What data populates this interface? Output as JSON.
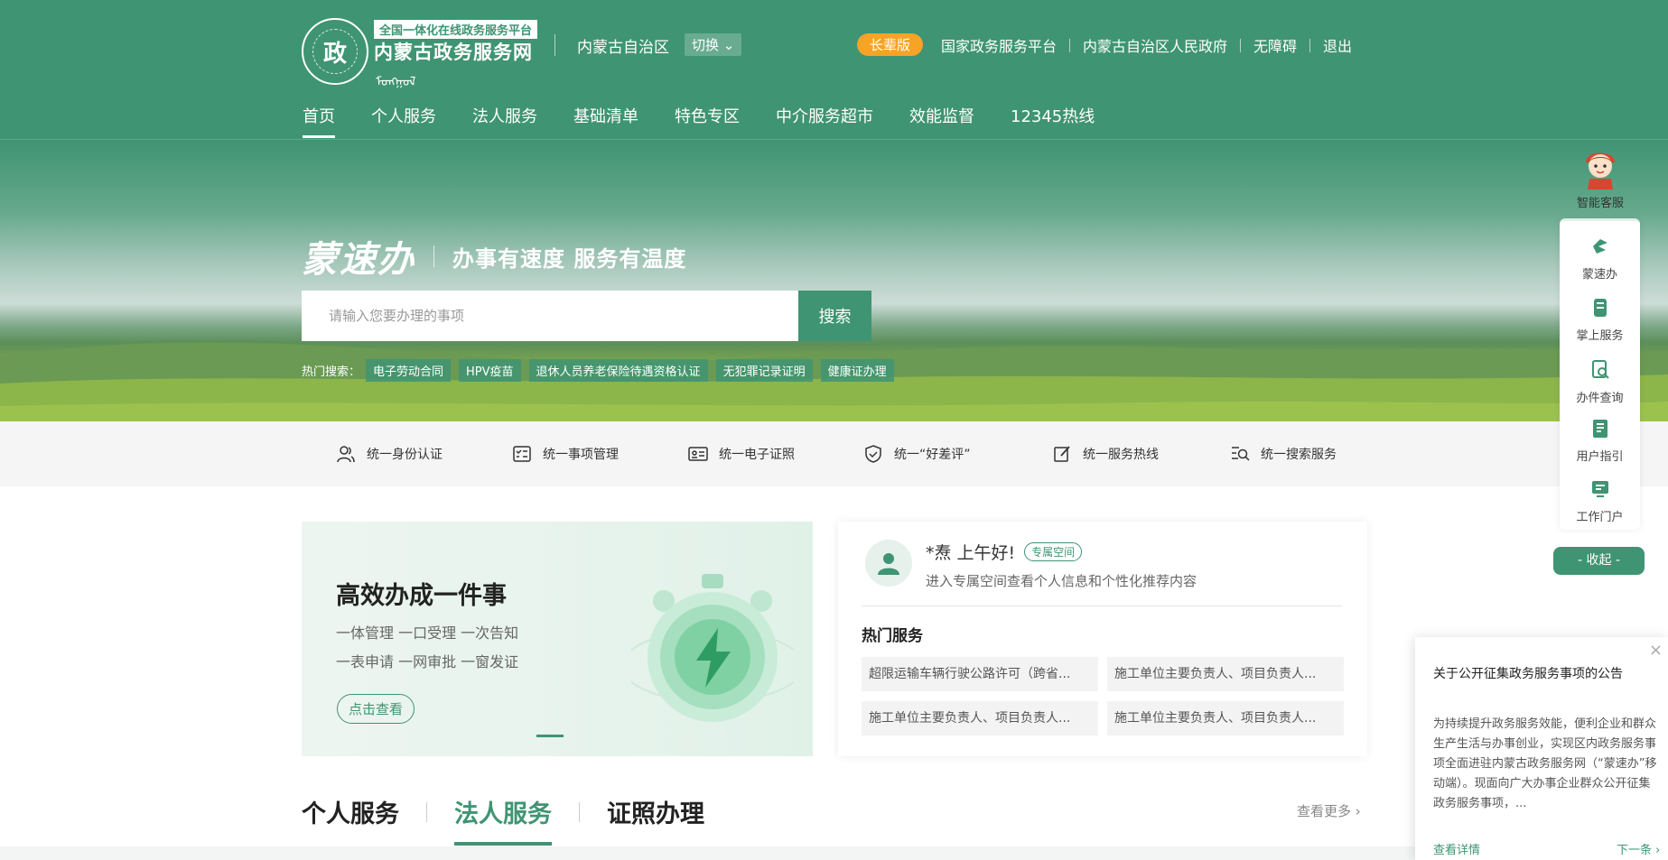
{
  "header": {
    "logo_tag": "全国一体化在线政务服务平台",
    "logo_name": "内蒙古政务服务网",
    "logo_emblem_text": "政",
    "region": "内蒙古自治区",
    "switch_label": "切换",
    "elder_label": "长辈版",
    "links": [
      "国家政务服务平台",
      "内蒙古自治区人民政府",
      "无障碍",
      "退出"
    ]
  },
  "nav": [
    "首页",
    "个人服务",
    "法人服务",
    "基础清单",
    "特色专区",
    "中介服务超市",
    "效能监督",
    "12345热线"
  ],
  "banner": {
    "calligraphy": "蒙速办",
    "slogan": "办事有速度  服务有温度",
    "search_placeholder": "请输入您要办理的事项",
    "search_button": "搜索",
    "hot_label": "热门搜索：",
    "hot_items": [
      "电子劳动合同",
      "HPV疫苗",
      "退休人员养老保险待遇资格认证",
      "无犯罪记录证明",
      "健康证办理"
    ]
  },
  "unified": [
    "统一身份认证",
    "统一事项管理",
    "统一电子证照",
    "统一“好差评”",
    "统一服务热线",
    "统一搜索服务"
  ],
  "promo": {
    "title": "高效办成一件事",
    "line1": "一体管理  一口受理  一次告知",
    "line2": "一表申请  一网审批  一窗发证",
    "button": "点击查看"
  },
  "user": {
    "greeting": "*焘 上午好!",
    "badge": "专属空间",
    "desc": "进入专属空间查看个人信息和个性化推荐内容",
    "hot_title": "热门服务",
    "services": [
      "超限运输车辆行驶公路许可（跨省...",
      "施工单位主要负责人、项目负责人...",
      "施工单位主要负责人、项目负责人...",
      "施工单位主要负责人、项目负责人..."
    ]
  },
  "tabs": [
    "个人服务",
    "法人服务",
    "证照办理"
  ],
  "see_more": "查看更多",
  "side": {
    "assistant": "智能客服",
    "items": [
      "蒙速办",
      "掌上服务",
      "办件查询",
      "用户指引",
      "工作门户"
    ],
    "collapse": "- 收起 -"
  },
  "notice": {
    "title": "关于公开征集政务服务事项的公告",
    "body": "为持续提升政务服务效能，便利企业和群众生产生活与办事创业，实现区内政务服务事项全面进驻内蒙古政务服务网（“蒙速办”移动端）。现面向广大办事企业群众公开征集政务服务事项，...",
    "detail": "查看详情",
    "next": "下一条"
  },
  "colors": {
    "primary": "#3f9473",
    "accent": "#f7a326"
  }
}
